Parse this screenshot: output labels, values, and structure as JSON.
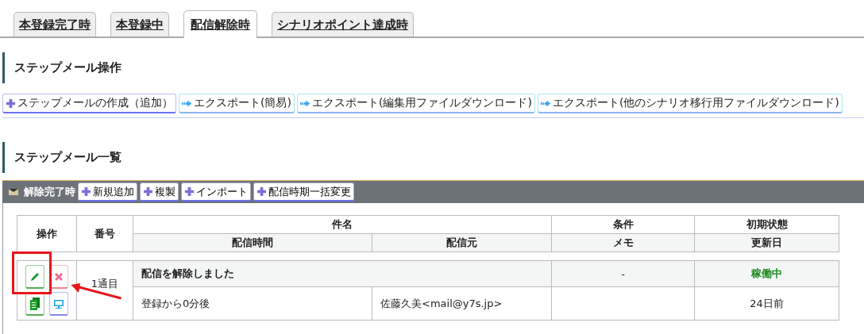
{
  "tabs": [
    {
      "label": "本登録完了時",
      "selected": false
    },
    {
      "label": "本登録中",
      "selected": false
    },
    {
      "label": "配信解除時",
      "selected": true
    },
    {
      "label": "シナリオポイント達成時",
      "selected": false
    }
  ],
  "operations": {
    "heading": "ステップメール操作",
    "buttons": [
      {
        "label": "ステップメールの作成（追加）",
        "kind": "add"
      },
      {
        "label": "エクスポート(簡易)",
        "kind": "export"
      },
      {
        "label": "エクスポート(編集用ファイルダウンロード)",
        "kind": "export"
      },
      {
        "label": "エクスポート(他のシナリオ移行用ファイルダウンロード)",
        "kind": "export"
      }
    ]
  },
  "list": {
    "heading": "ステップメール一覧",
    "group_title": "解除完了時",
    "group_buttons": [
      "新規追加",
      "複製",
      "インポート",
      "配信時期一括変更"
    ],
    "header_top": [
      "操作",
      "番号",
      "件名",
      "条件",
      "初期状態"
    ],
    "header_bottom": [
      "配信時間",
      "配信元",
      "メモ",
      "更新日"
    ],
    "rows": [
      {
        "number": "1通目",
        "subject": "配信を解除しました",
        "condition": "-",
        "status": "稼働中",
        "timing": "登録から0分後",
        "sender": "佐藤久美<mail@y7s.jp>",
        "updated": "24日前"
      }
    ]
  }
}
